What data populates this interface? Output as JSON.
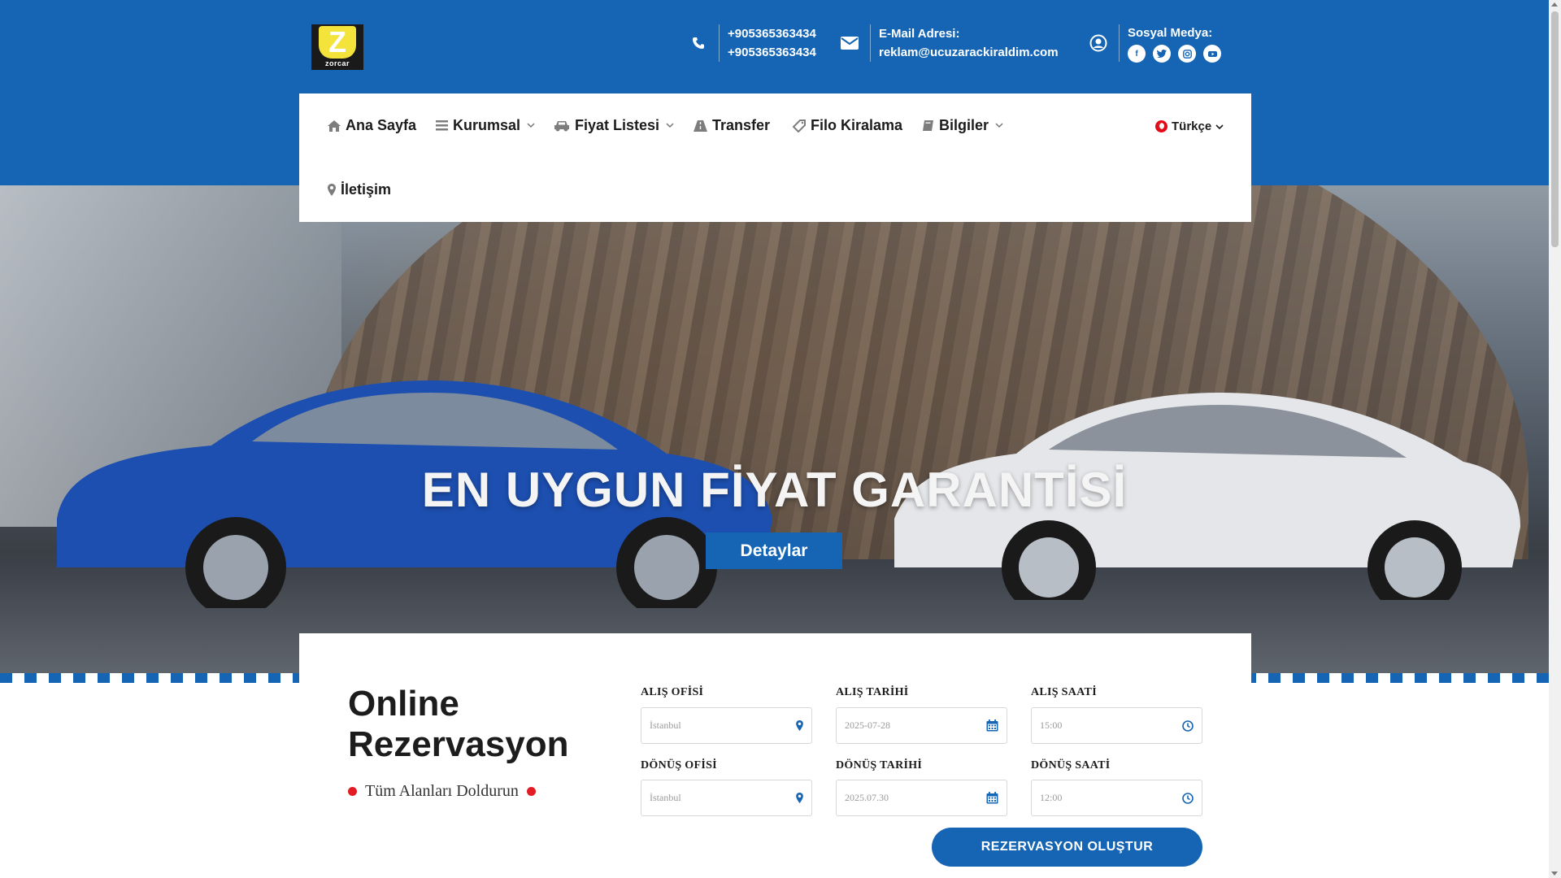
{
  "header": {
    "logo_text": "zorcar",
    "logo_letter": "Z",
    "phone_1": "+905365363434",
    "phone_2": "+905365363434",
    "email_label": "E-Mail Adresi:",
    "email_value": "reklam@ucuzarackiraldim.com",
    "social_label": "Sosyal Medya:",
    "social_icons": [
      "facebook-icon",
      "twitter-icon",
      "instagram-icon",
      "youtube-icon"
    ]
  },
  "nav": {
    "items": [
      {
        "label": "Ana Sayfa",
        "icon": "home-icon",
        "has_dropdown": false
      },
      {
        "label": "Kurumsal",
        "icon": "bars-icon",
        "has_dropdown": true
      },
      {
        "label": "Fiyat Listesi",
        "icon": "car-icon",
        "has_dropdown": true
      },
      {
        "label": "Transfer",
        "icon": "road-icon",
        "has_dropdown": false
      },
      {
        "label": "Filo Kiralama",
        "icon": "tag-icon",
        "has_dropdown": false
      },
      {
        "label": "Bilgiler",
        "icon": "book-icon",
        "has_dropdown": true
      },
      {
        "label": "İletişim",
        "icon": "map-marker-icon",
        "has_dropdown": false
      }
    ],
    "language": "Türkçe"
  },
  "hero": {
    "title": "EN UYGUN FİYAT GARANTİSİ",
    "button_label": "Detaylar"
  },
  "reservation": {
    "title": "Online Rezervasyon",
    "subtitle": "Tüm Alanları Doldurun",
    "fields": {
      "pickup_office": {
        "label": "ALIŞ OFİSİ",
        "value": "İstanbul"
      },
      "pickup_date": {
        "label": "ALIŞ TARİHİ",
        "value": "2025-07-28"
      },
      "pickup_time": {
        "label": "ALIŞ SAATİ",
        "value": "15:00"
      },
      "return_office": {
        "label": "DÖNÜŞ OFİSİ",
        "value": "İstanbul"
      },
      "return_date": {
        "label": "DÖNÜŞ TARİHİ",
        "value": "2025.07.30"
      },
      "return_time": {
        "label": "DÖNÜŞ SAATİ",
        "value": "12:00"
      }
    },
    "submit_label": "REZERVASYON OLUŞTUR"
  },
  "colors": {
    "primary": "#1565b4",
    "accent_dot": "#e31b23"
  }
}
